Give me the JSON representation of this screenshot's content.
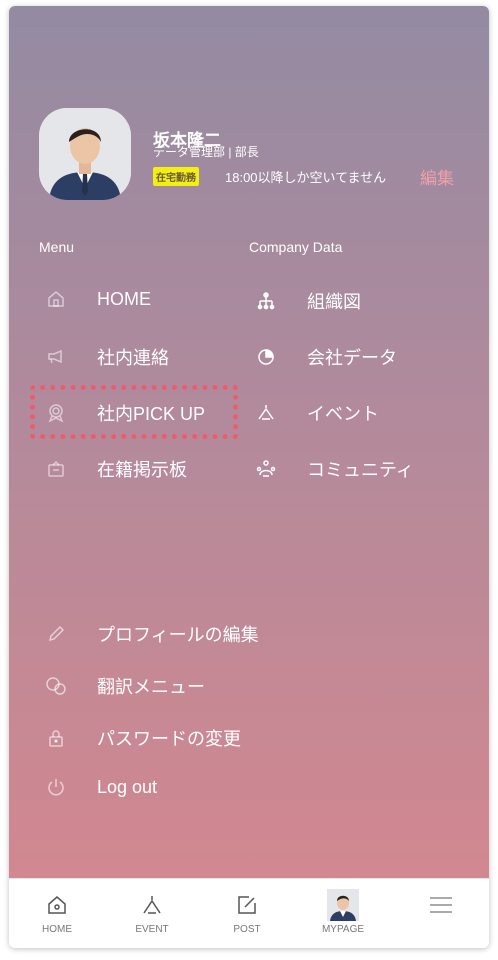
{
  "profile": {
    "name": "坂本隆二",
    "department": "データ管理部 | 部長",
    "status_badge": "在宅勤務",
    "availability": "18:00以降しか空いてません",
    "edit_label": "編集"
  },
  "menu": {
    "header": "Menu",
    "items": [
      {
        "label": "HOME",
        "icon": "house-icon"
      },
      {
        "label": "社内連絡",
        "icon": "megaphone-icon"
      },
      {
        "label": "社内PICK UP",
        "icon": "badge-icon"
      },
      {
        "label": "在籍掲示板",
        "icon": "board-icon"
      }
    ]
  },
  "company": {
    "header": "Company Data",
    "items": [
      {
        "label": "組織図",
        "icon": "org-chart-icon"
      },
      {
        "label": "会社データ",
        "icon": "pie-chart-icon"
      },
      {
        "label": "イベント",
        "icon": "event-icon"
      },
      {
        "label": "コミュニティ",
        "icon": "community-icon"
      }
    ]
  },
  "settings": {
    "items": [
      {
        "label": "プロフィールの編集",
        "icon": "pencil-icon"
      },
      {
        "label": "翻訳メニュー",
        "icon": "translate-icon"
      },
      {
        "label": "パスワードの変更",
        "icon": "lock-icon"
      },
      {
        "label": "Log out",
        "icon": "power-icon"
      }
    ]
  },
  "tabbar": {
    "tabs": [
      {
        "label": "HOME",
        "icon": "house-icon"
      },
      {
        "label": "EVENT",
        "icon": "event-icon"
      },
      {
        "label": "POST",
        "icon": "post-icon"
      },
      {
        "label": "MYPAGE",
        "icon": "avatar"
      },
      {
        "label": "",
        "icon": "hamburger-icon"
      }
    ]
  },
  "colors": {
    "highlight": "#ef5b6d",
    "badge": "#f2f011",
    "edit": "#f0a0a8"
  }
}
